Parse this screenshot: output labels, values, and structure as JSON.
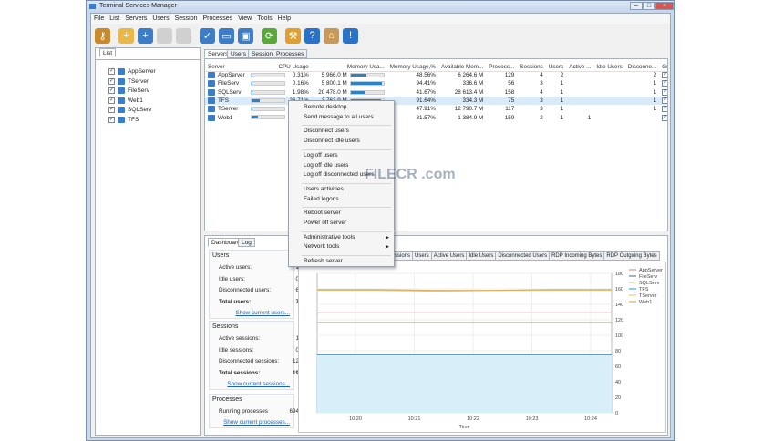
{
  "window": {
    "title": "Terminal Services Manager"
  },
  "menu": [
    "File",
    "List",
    "Servers",
    "Users",
    "Session",
    "Processes",
    "View",
    "Tools",
    "Help"
  ],
  "toolbar": [
    "key-icon",
    "add-folder-icon",
    "add-server-icon",
    "disabled-icon",
    "disabled-icon",
    "connect-icon",
    "monitor-icon",
    "monitor-check-icon",
    "refresh-icon",
    "wrench-icon",
    "help-icon",
    "home-icon",
    "info-icon"
  ],
  "left_panel": {
    "tab": "List",
    "items": [
      "AppServer",
      "TServer",
      "FileServ",
      "Web1",
      "SQLServ",
      "TFS"
    ]
  },
  "main_tabs": [
    "Servers",
    "Users",
    "Sessions",
    "Processes"
  ],
  "table": {
    "columns": [
      "Server",
      "CPU Usage",
      "Memory Usa...",
      "Memory Usage,%",
      "Available Mem...",
      "Process...",
      "Sessions",
      "Users",
      "Active ...",
      "Idle Users",
      "Disconne...",
      "Graph"
    ],
    "rows": [
      {
        "name": "AppServer",
        "cpu": "0.31%",
        "cpu_pct": 0.31,
        "mem": "5 966.0 M",
        "mem_pct": 48.56,
        "memp": "48.56%",
        "avail": "6 264.6 M",
        "proc": "129",
        "sess": "4",
        "users": "2",
        "active": "",
        "idle": "",
        "disc": "2",
        "color": "#e07070"
      },
      {
        "name": "FileServ",
        "cpu": "0.16%",
        "cpu_pct": 0.16,
        "mem": "5 800.1 M",
        "mem_pct": 94.41,
        "memp": "94.41%",
        "avail": "336.6 M",
        "proc": "56",
        "sess": "3",
        "users": "1",
        "active": "",
        "idle": "",
        "disc": "1",
        "color": "#9a8ac8"
      },
      {
        "name": "SQLServ",
        "cpu": "1.98%",
        "cpu_pct": 1.98,
        "mem": "20 478.0 M",
        "mem_pct": 41.67,
        "memp": "41.67%",
        "avail": "28 613.4 M",
        "proc": "158",
        "sess": "4",
        "users": "1",
        "active": "",
        "idle": "",
        "disc": "1",
        "color": "#c8d890"
      },
      {
        "name": "TFS",
        "cpu": "26.71%",
        "cpu_pct": 26.71,
        "mem": "3 763.9 M",
        "mem_pct": 91.64,
        "memp": "91.64%",
        "avail": "334.3 M",
        "proc": "75",
        "sess": "3",
        "users": "1",
        "active": "",
        "idle": "",
        "disc": "1",
        "color": "#3aa0d8",
        "selected": true
      },
      {
        "name": "TServer",
        "cpu": "",
        "cpu_pct": 1,
        "mem": "",
        "mem_pct": 47.91,
        "memp": "47.91%",
        "avail": "12 790.7 M",
        "proc": "117",
        "sess": "3",
        "users": "1",
        "active": "",
        "idle": "",
        "disc": "1",
        "color": "#e8c860"
      },
      {
        "name": "Web1",
        "cpu": "",
        "cpu_pct": 20,
        "mem": "",
        "mem_pct": 81.57,
        "memp": "81.57%",
        "avail": "1 384.9 M",
        "proc": "159",
        "sess": "2",
        "users": "1",
        "active": "1",
        "idle": "",
        "disc": "",
        "color": "#e8b070"
      }
    ]
  },
  "bottom_tabs": [
    "Dashboard",
    "Log"
  ],
  "dashboard": {
    "users": {
      "title": "Users",
      "rows": [
        [
          "Active users:",
          "1"
        ],
        [
          "Idle users:",
          "0"
        ],
        [
          "Disconnected users:",
          "6"
        ],
        [
          "Total users:",
          "7"
        ]
      ],
      "link": "Show current users..."
    },
    "sessions": {
      "title": "Sessions",
      "rows": [
        [
          "Active sessions:",
          "1"
        ],
        [
          "Idle sessions:",
          "0"
        ],
        [
          "Disconnected sessions:",
          "12"
        ],
        [
          "Total sessions:",
          "19"
        ]
      ],
      "link": "Show current sessions..."
    },
    "processes": {
      "title": "Processes",
      "rows": [
        [
          "Running processes",
          "694"
        ]
      ],
      "link": "Show current processes..."
    }
  },
  "chart_tabs": [
    "...ssions",
    "Users",
    "Active Users",
    "Idle Users",
    "Disconnected Users",
    "RDP Incoming Bytes",
    "RDP Outgoing Bytes"
  ],
  "context_menu": [
    [
      "Remote desktop",
      "Send message to all users"
    ],
    [
      "Disconnect users",
      "Disconnect idle users"
    ],
    [
      "Log off users",
      "Log off idle users",
      "Log off disconnected users"
    ],
    [
      "Users activities",
      "Failed logons"
    ],
    [
      "Reboot server",
      "Power off server"
    ],
    [
      "Administrative tools",
      "Network tools"
    ],
    [
      "Refresh server"
    ]
  ],
  "watermark": "FILECR .com",
  "chart_data": {
    "type": "line",
    "xlabel": "Time",
    "ylabel": "",
    "ylim": [
      0,
      180
    ],
    "yticks": [
      "0",
      "20",
      "40",
      "60",
      "80",
      "100",
      "120",
      "140",
      "160",
      "180"
    ],
    "xticks": [
      "10:20",
      "10:21",
      "10:22",
      "10:23",
      "10:24"
    ],
    "legend_position": "right",
    "series": [
      {
        "name": "AppServer",
        "color": "#e89090",
        "values": [
          129,
          129,
          129,
          129,
          129,
          129
        ]
      },
      {
        "name": "FileServ",
        "color": "#6a7ab8",
        "values": [
          56,
          56,
          56,
          56,
          56,
          56
        ]
      },
      {
        "name": "SQLServ",
        "color": "#c8d890",
        "values": [
          158,
          158,
          157,
          158,
          158,
          158
        ]
      },
      {
        "name": "TFS",
        "color": "#3aa8e0",
        "values": [
          75,
          75,
          75,
          75,
          75,
          75
        ],
        "fill": true
      },
      {
        "name": "TServer",
        "color": "#e8d070",
        "values": [
          117,
          117,
          117,
          117,
          117,
          117
        ]
      },
      {
        "name": "Web1",
        "color": "#d8b060",
        "values": [
          159,
          159,
          158,
          158,
          159,
          159
        ]
      }
    ]
  }
}
